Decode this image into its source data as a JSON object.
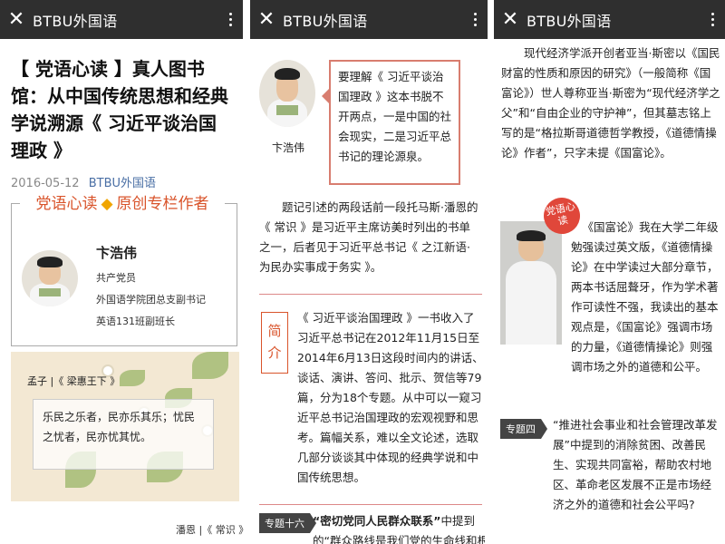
{
  "panels": [
    {
      "header": {
        "title": "BTBU外国语"
      }
    },
    {
      "header": {
        "title": "BTBU外国语"
      }
    },
    {
      "header": {
        "title": "BTBU外国语"
      }
    }
  ],
  "article": {
    "title": "【 党语心读 】真人图书馆：从中国传统思想和经典学说溯源《 习近平谈治国理政 》",
    "date": "2016-05-12",
    "account": "BTBU外国语"
  },
  "author_card": {
    "heading_left": "党语心读",
    "heading_right": "原创专栏作者",
    "name": "卞浩伟",
    "line1": "共产党员",
    "line2": "外国语学院团总支副书记",
    "line3": "英语131班副班长"
  },
  "quote": {
    "source": "孟子 |《 梁惠王下 》",
    "text": "乐民之乐者，民亦乐其乐；忧民之忧者，民亦忧其忧。",
    "cite": "潘恩 |《 常识 》"
  },
  "panel2": {
    "person_name": "卞浩伟",
    "callout": "要理解《 习近平谈治国理政 》这本书脱不开两点，一是中国的社会现实，二是习近平总书记的理论源泉。",
    "para1": "题记引述的两段话前一段托马斯·潘恩的《 常识 》是习近平主席访美时列出的书单之一，后者见于习近平总书记《 之江新语·为民办实事成于务实 》。",
    "intro_label": "简介",
    "intro": "《 习近平谈治国理政 》一书收入了习近平总书记在2012年11月15日至2014年6月13日这段时间内的讲话、谈话、演讲、答问、批示、贺信等79篇，分为18个专题。从中可以一窥习近平总书记治国理政的宏观视野和思考。篇幅关系，难以全文论述，选取几部分谈谈其中体现的经典学说和中国传统思想。",
    "topic_tag": "专题十六",
    "topic_bold": "“密切党同人民群众联系”",
    "topic_text": "中提到",
    "topic_cut": "的“群众路线是我们党的生命线和根"
  },
  "panel3": {
    "para1": "现代经济学派开创者亚当·斯密以《国民财富的性质和原因的研究》（一般简称《国富论》）世人尊称亚当·斯密为“现代经济学之父”和“自由企业的守护神”，但其墓志铭上写的是“格拉斯哥道德哲学教授，《道德情操论》作者”，只字未提《国富论》。",
    "seal": "党语心读",
    "para2": "《国富论》我在大学二年级勉强读过英文版，《道德情操论》在中学读过大部分章节，两本书话屈聱牙，作为学术著作可读性不强，我读出的基本观点是，《国富论》强调市场的力量，《道德情操论》则强调市场之外的道德和公平。",
    "topic_tag": "专题四",
    "topic_text": "“推进社会事业和社会管理改革发展”中提到的消除贫困、改善民生、实现共同富裕，帮助农村地区、革命老区发展不正是市场经济之外的道德和社会公平吗?"
  },
  "colors": {
    "header_bg": "#2f2f2f",
    "accent": "#d9542b",
    "link": "#4a6fa5"
  }
}
